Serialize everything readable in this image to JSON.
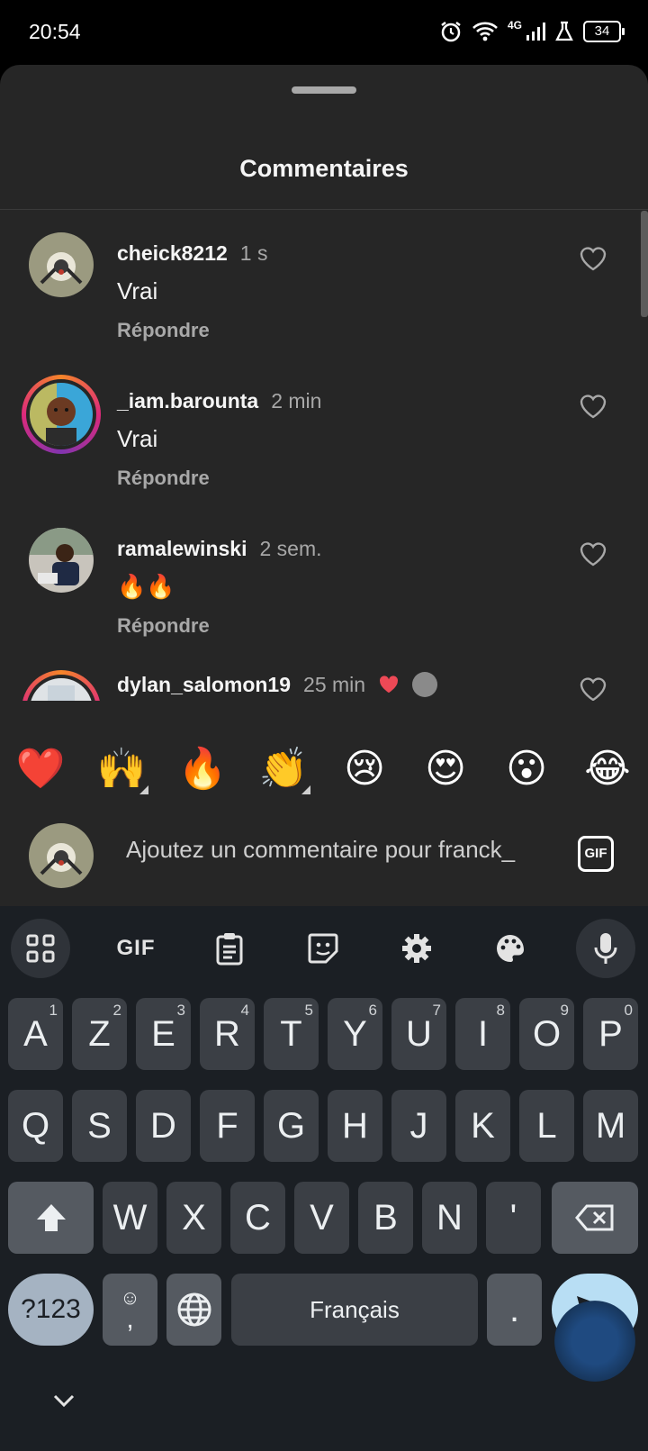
{
  "status_bar": {
    "time": "20:54",
    "network": "4G",
    "battery": "34"
  },
  "sheet": {
    "title": "Commentaires"
  },
  "comments": [
    {
      "user": "cheick8212",
      "time": "1 s",
      "text": "Vrai",
      "reply": "Répondre"
    },
    {
      "user": "_iam.barounta",
      "time": "2 min",
      "text": "Vrai",
      "reply": "Répondre"
    },
    {
      "user": "ramalewinski",
      "time": "2 sem.",
      "text": "🔥🔥",
      "reply": "Répondre"
    },
    {
      "user": "dylan_salomon19",
      "time": "25 min",
      "text": "",
      "reply": ""
    }
  ],
  "emoji_bar": [
    "❤️",
    "🙌",
    "🔥",
    "👏",
    "😢",
    "😍",
    "😮",
    "😂"
  ],
  "input": {
    "placeholder": "Ajoutez un commentaire pour franck_",
    "gif_label": "GIF"
  },
  "keyboard": {
    "toolbar_gif": "GIF",
    "row1": [
      {
        "k": "A",
        "s": "1"
      },
      {
        "k": "Z",
        "s": "2"
      },
      {
        "k": "E",
        "s": "3"
      },
      {
        "k": "R",
        "s": "4"
      },
      {
        "k": "T",
        "s": "5"
      },
      {
        "k": "Y",
        "s": "6"
      },
      {
        "k": "U",
        "s": "7"
      },
      {
        "k": "I",
        "s": "8"
      },
      {
        "k": "O",
        "s": "9"
      },
      {
        "k": "P",
        "s": "0"
      }
    ],
    "row2": [
      "Q",
      "S",
      "D",
      "F",
      "G",
      "H",
      "J",
      "K",
      "L",
      "M"
    ],
    "row3": [
      "W",
      "X",
      "C",
      "V",
      "B",
      "N",
      "'"
    ],
    "numbers_key": "?123",
    "comma_key": ",",
    "space_label": "Français",
    "period_key": "."
  }
}
